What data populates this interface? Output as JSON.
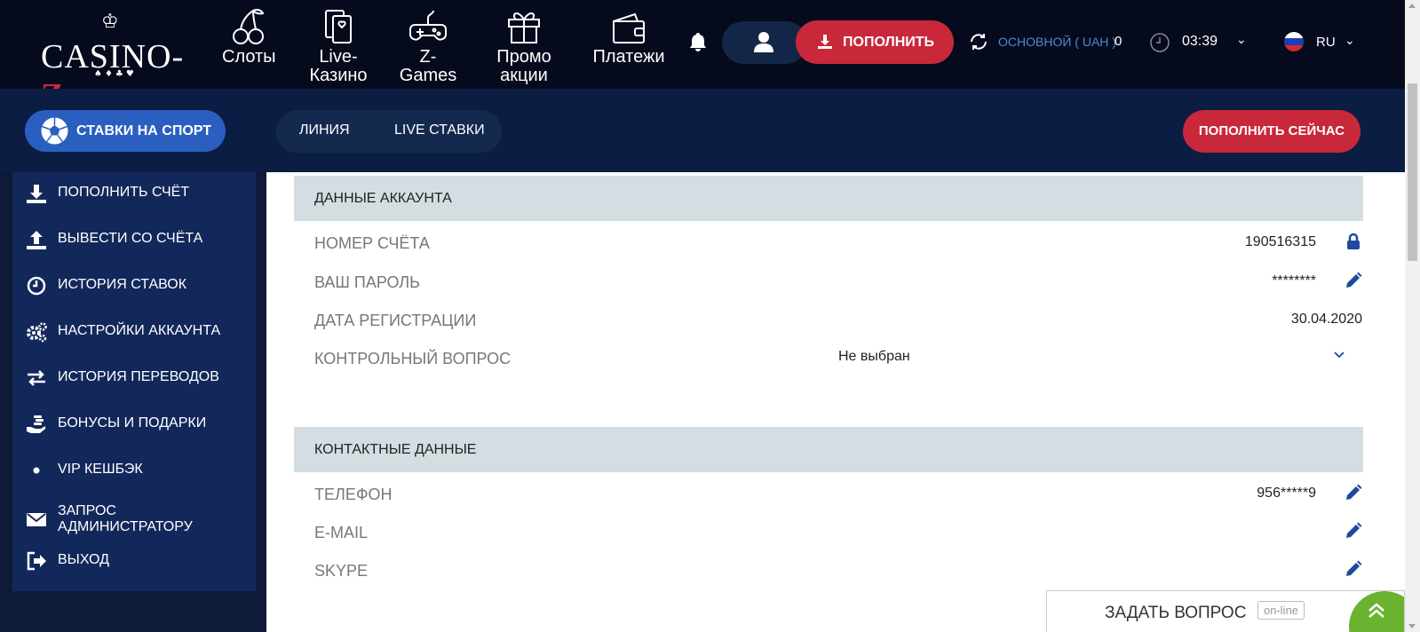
{
  "header": {
    "logo": {
      "text": "CASINO-",
      "accent": "Z",
      "suits": "♠♦♣♥"
    },
    "nav": [
      {
        "label": "Слоты",
        "icon": "cherries-icon"
      },
      {
        "label": "Live-Казино",
        "icon": "cards-icon"
      },
      {
        "label": "Z-Games",
        "icon": "gamepad-icon"
      },
      {
        "label": "Промо акции",
        "icon": "gift-icon"
      },
      {
        "label": "Платежи",
        "icon": "wallet-icon"
      }
    ],
    "deposit_label": "ПОПОЛНИТЬ",
    "balance_label": "ОСНОВНОЙ ( UAH )",
    "balance_value": "0",
    "time": "03:39",
    "language": "RU"
  },
  "secondary": {
    "sport_label": "СТАВКИ НА СПОРТ",
    "tabs": [
      "ЛИНИЯ",
      "LIVE СТАВКИ"
    ],
    "pay_now_label": "ПОПОЛНИТЬ СЕЙЧАС"
  },
  "sidebar": {
    "items": [
      {
        "label": "ПОПОЛНИТЬ СЧЁТ",
        "icon": "download-icon"
      },
      {
        "label": "ВЫВЕСТИ СО СЧЁТА",
        "icon": "upload-icon"
      },
      {
        "label": "ИСТОРИЯ СТАВОК",
        "icon": "clock-icon"
      },
      {
        "label": "НАСТРОЙКИ АККАУНТА",
        "icon": "gears-icon"
      },
      {
        "label": "ИСТОРИЯ ПЕРЕВОДОВ",
        "icon": "transfer-arrows-icon"
      },
      {
        "label": "БОНУСЫ И ПОДАРКИ",
        "icon": "hand-coins-icon"
      },
      {
        "label": "VIP КЕШБЭК",
        "icon": "dot-icon"
      },
      {
        "label": "ЗАПРОС АДМИНИСТРАТОРУ",
        "icon": "envelope-icon"
      },
      {
        "label": "ВЫХОД",
        "icon": "logout-icon"
      }
    ]
  },
  "account": {
    "title": "ДАННЫЕ АККАУНТА",
    "rows": [
      {
        "label": "НОМЕР СЧЁТА",
        "value": "190516315",
        "action": "lock-icon"
      },
      {
        "label": "ВАШ ПАРОЛЬ",
        "value": "********",
        "action": "pencil-icon"
      },
      {
        "label": "ДАТА РЕГИСТРАЦИИ",
        "value": "30.04.2020"
      },
      {
        "label": "КОНТРОЛЬНЫЙ ВОПРОС",
        "value": "Не выбран",
        "action": "chevron-down-icon"
      }
    ]
  },
  "contacts": {
    "title": "КОНТАКТНЫЕ ДАННЫЕ",
    "rows": [
      {
        "label": "ТЕЛЕФОН",
        "value": "956*****9",
        "action": "pencil-icon"
      },
      {
        "label": "E-MAIL",
        "value": "",
        "action": "pencil-icon"
      },
      {
        "label": "SKYPE",
        "value": "",
        "action": "pencil-icon"
      }
    ]
  },
  "support": {
    "label": "ЗАДАТЬ ВОПРОС",
    "status": "on-line"
  },
  "colors": {
    "header_bg": "#050b1d",
    "secondary_bg": "#0c1d44",
    "sidebar_bg": "#13285a",
    "accent_red": "#c8283a",
    "accent_blue": "#2a5fc0",
    "section_bg": "#d3dde2",
    "icon_blue": "#1f4a9c"
  }
}
